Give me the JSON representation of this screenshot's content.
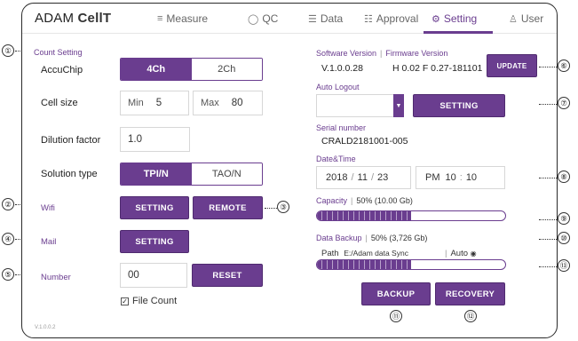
{
  "app": {
    "brand_regular": "ADAM ",
    "brand_bold": "CellT"
  },
  "nav": [
    {
      "label": "Measure",
      "icon": "list-icon"
    },
    {
      "label": "QC",
      "icon": "shield-icon"
    },
    {
      "label": "Data",
      "icon": "list-icon"
    },
    {
      "label": "Approval",
      "icon": "approval-icon"
    },
    {
      "label": "Setting",
      "icon": "gear-icon",
      "active": true
    },
    {
      "label": "User",
      "icon": "user-icon"
    }
  ],
  "count_setting": {
    "title": "Count Setting",
    "accuchip_label": "AccuChip",
    "accuchip_options": [
      "4Ch",
      "2Ch"
    ],
    "cell_size_label": "Cell size",
    "min_label": "Min",
    "min_value": "5",
    "max_label": "Max",
    "max_value": "80",
    "dilution_label": "Dilution factor",
    "dilution_value": "1.0",
    "solution_label": "Solution type",
    "solution_options": [
      "TPI/N",
      "TAO/N"
    ]
  },
  "wifi": {
    "label": "Wifi",
    "setting_btn": "SETTING",
    "remote_btn": "REMOTE"
  },
  "mail": {
    "label": "Mail",
    "setting_btn": "SETTING"
  },
  "number": {
    "label": "Number",
    "value": "00",
    "reset_btn": "RESET",
    "file_count_label": "File Count",
    "file_count_checked": true
  },
  "software": {
    "sw_label": "Software Version",
    "fw_label": "Firmware Version",
    "sw_value": "V.1.0.0.28",
    "fw_value": "H 0.02 F 0.27-181101",
    "update_btn": "UPDATE"
  },
  "auto_logout": {
    "label": "Auto Logout",
    "value": "",
    "setting_btn": "SETTING"
  },
  "serial": {
    "label": "Serial number",
    "value": "CRALD2181001-005"
  },
  "datetime": {
    "label": "Date&Time",
    "year": "2018",
    "month": "11",
    "day": "23",
    "ampm": "PM",
    "hour": "10",
    "minute": "10"
  },
  "capacity": {
    "label": "Capacity",
    "value": "50% (10.00 Gb)",
    "fill_fraction": 0.5
  },
  "backup": {
    "label": "Data Backup",
    "value": "50% (3,726 Gb)",
    "path_label": "Path",
    "path_value": "E:/Adam data Sync",
    "auto_label": "Auto",
    "fill_fraction": 0.5,
    "backup_btn": "BACKUP",
    "recovery_btn": "RECOVERY"
  },
  "footer_version": "V.1.0.0.2",
  "callouts": [
    "①",
    "②",
    "③",
    "④",
    "⑤",
    "⑥",
    "⑦",
    "⑧",
    "⑨",
    "⑩",
    "⑪",
    "⑫",
    "⑬"
  ],
  "colors": {
    "accent": "#6a3d8f"
  }
}
